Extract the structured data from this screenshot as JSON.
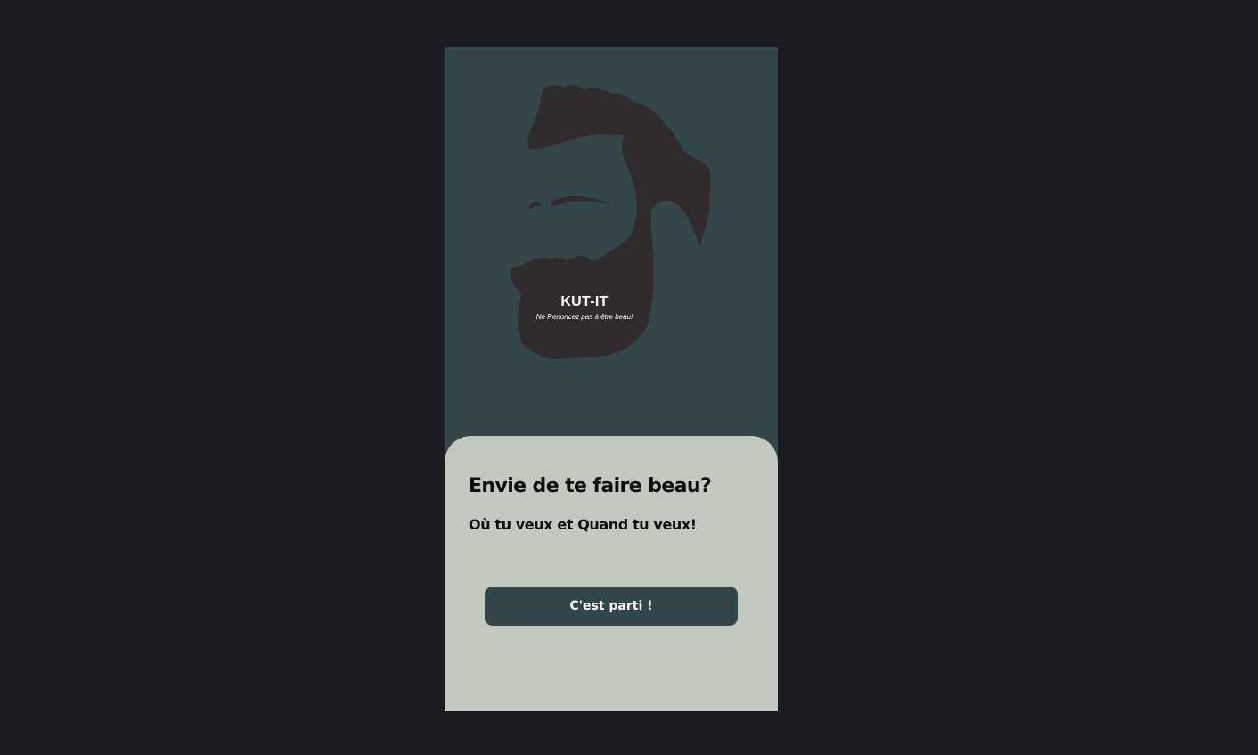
{
  "app": {
    "brand_name": "KUT-IT",
    "tagline": "Ne Renoncez pas à être beau!",
    "logo_icon": "bearded-man-silhouette-icon"
  },
  "onboarding": {
    "title": "Envie de te faire beau?",
    "subtitle": "Où tu veux et Quand tu veux!",
    "cta_label": "C'est parti !"
  },
  "colors": {
    "page_background": "#1b1c22",
    "hero_background": "#33474b",
    "card_background": "#c4c9bf",
    "logo_silhouette": "#312c2c",
    "button_background": "#33474b",
    "button_text": "#ffffff",
    "text_primary": "#0d0d0d"
  }
}
